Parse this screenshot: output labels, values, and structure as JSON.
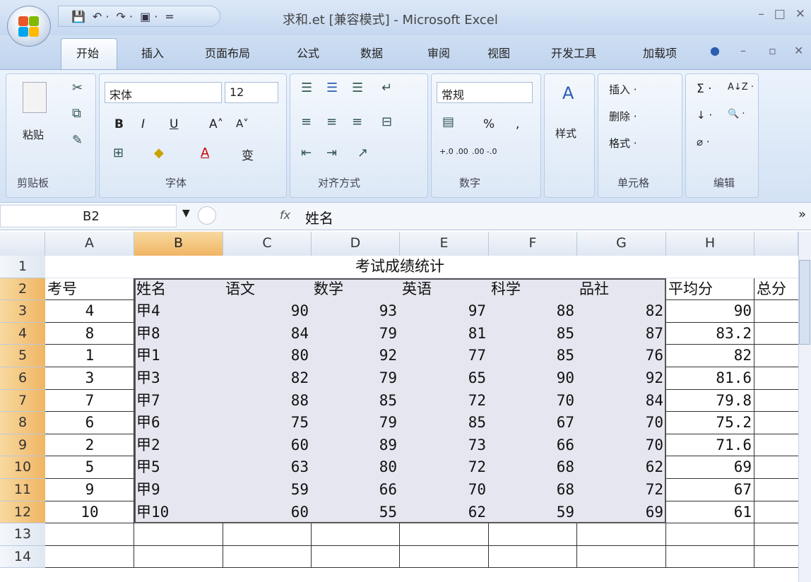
{
  "window": {
    "title": "求和.et  [兼容模式] - Microsoft Excel",
    "min": "–",
    "max": "□",
    "close": "✕"
  },
  "qat": {
    "save": "💾",
    "undo": "↶ ·",
    "redo": "↷ ·",
    "misc": "▣ ·",
    "more": "="
  },
  "tabs": [
    "开始",
    "插入",
    "页面布局",
    "公式",
    "数据",
    "审阅",
    "视图",
    "开发工具",
    "加载项"
  ],
  "ribbon": {
    "clipboard": {
      "label": "剪贴板",
      "paste": "粘贴"
    },
    "font": {
      "label": "字体",
      "name": "宋体",
      "size": "12",
      "bold": "B",
      "italic": "I",
      "underline": "U",
      "grow": "A˄",
      "shrink": "A˅",
      "color": "A",
      "wen": "变"
    },
    "align": {
      "label": "对齐方式"
    },
    "number": {
      "label": "数字",
      "format": "常规",
      "pct": "%",
      "comma": ",",
      "inc": "+.0 .00",
      "dec": ".00 -.0"
    },
    "styles": {
      "label": "样式",
      "btn": "样式"
    },
    "cells": {
      "label": "单元格",
      "insert": "插入 ·",
      "delete": "删除 ·",
      "format": "格式 ·"
    },
    "editing": {
      "label": "编辑",
      "sum": "Σ ·",
      "sort": "A↓Z ·",
      "fill": "↓ ·",
      "find": "🔍 ·",
      "clear": "⌀ ·"
    }
  },
  "formulabar": {
    "namebox": "B2",
    "fx": "fx",
    "formula": "姓名"
  },
  "columns": [
    "A",
    "B",
    "C",
    "D",
    "E",
    "F",
    "G",
    "H"
  ],
  "rows": [
    "1",
    "2",
    "3",
    "4",
    "5",
    "6",
    "7",
    "8",
    "9",
    "10",
    "11",
    "12",
    "13",
    "14"
  ],
  "title_row": "考试成绩统计",
  "headers": [
    "考号",
    "姓名",
    "语文",
    "数学",
    "英语",
    "科学",
    "品社",
    "平均分",
    "总分"
  ],
  "data": [
    [
      "4",
      "甲4",
      "90",
      "93",
      "97",
      "88",
      "82",
      "90"
    ],
    [
      "8",
      "甲8",
      "84",
      "79",
      "81",
      "85",
      "87",
      "83.2"
    ],
    [
      "1",
      "甲1",
      "80",
      "92",
      "77",
      "85",
      "76",
      "82"
    ],
    [
      "3",
      "甲3",
      "82",
      "79",
      "65",
      "90",
      "92",
      "81.6"
    ],
    [
      "7",
      "甲7",
      "88",
      "85",
      "72",
      "70",
      "84",
      "79.8"
    ],
    [
      "6",
      "甲6",
      "75",
      "79",
      "85",
      "67",
      "70",
      "75.2"
    ],
    [
      "2",
      "甲2",
      "60",
      "89",
      "73",
      "66",
      "70",
      "71.6"
    ],
    [
      "5",
      "甲5",
      "63",
      "80",
      "72",
      "68",
      "62",
      "69"
    ],
    [
      "9",
      "甲9",
      "59",
      "66",
      "70",
      "68",
      "72",
      "67"
    ],
    [
      "10",
      "甲10",
      "60",
      "55",
      "62",
      "59",
      "69",
      "61"
    ]
  ]
}
